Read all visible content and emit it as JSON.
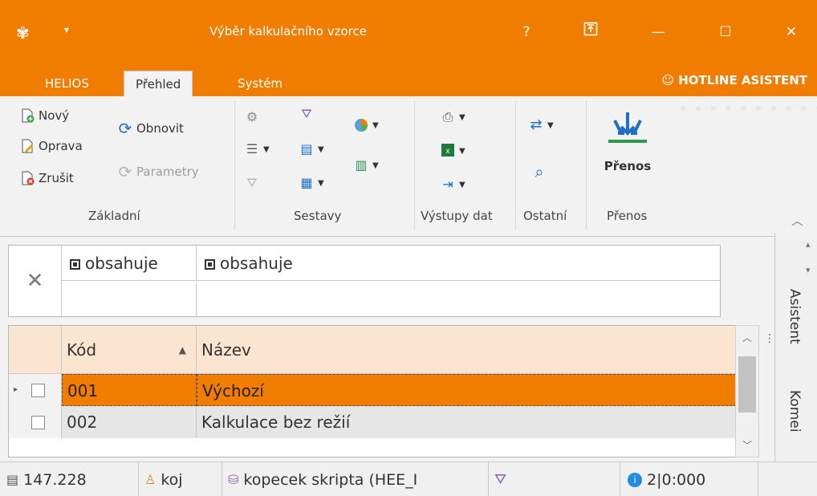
{
  "window": {
    "title": "Výběr kalkulačního vzorce",
    "help_label": "?",
    "minimize_label": "—",
    "maximize_label": "☐",
    "close_label": "✕",
    "qa_label": "▾"
  },
  "tabs": [
    {
      "label": "HELIOS"
    },
    {
      "label": "Přehled"
    },
    {
      "label": "Systém"
    }
  ],
  "hotline": {
    "label": "HOTLINE ASISTENT"
  },
  "ribbon": {
    "zakladni": {
      "novy": "Nový",
      "oprava": "Oprava",
      "zrusit": "Zrušit",
      "obnovit": "Obnovit",
      "parametry": "Parametry",
      "group": "Základní"
    },
    "sestavy": {
      "group": "Sestavy"
    },
    "vystupy": {
      "group": "Výstupy dat"
    },
    "ostatni": {
      "group": "Ostatní"
    },
    "prenos": {
      "button": "Přenos",
      "group": "Přenos"
    }
  },
  "filter": {
    "col1_op": "obsahuje",
    "col2_op": "obsahuje",
    "col1_value": "",
    "col2_value": ""
  },
  "grid": {
    "columns": [
      {
        "label": "Kód"
      },
      {
        "label": "Název"
      }
    ],
    "rows": [
      {
        "kod": "001",
        "nazev": "Výchozí"
      },
      {
        "kod": "002",
        "nazev": "Kalkulace bez režií"
      }
    ]
  },
  "side_tabs": [
    {
      "label": "Asistent"
    },
    {
      "label": "Komei"
    }
  ],
  "status": {
    "record": "147.228",
    "user": "koj",
    "database": "kopecek skripta (HEE_I",
    "info": "2|0:000"
  },
  "colors": {
    "accent": "#f07d00",
    "header_bg": "#fbe5d1",
    "selected_row": "#f07d00",
    "alt_row": "#e6e6e6"
  }
}
